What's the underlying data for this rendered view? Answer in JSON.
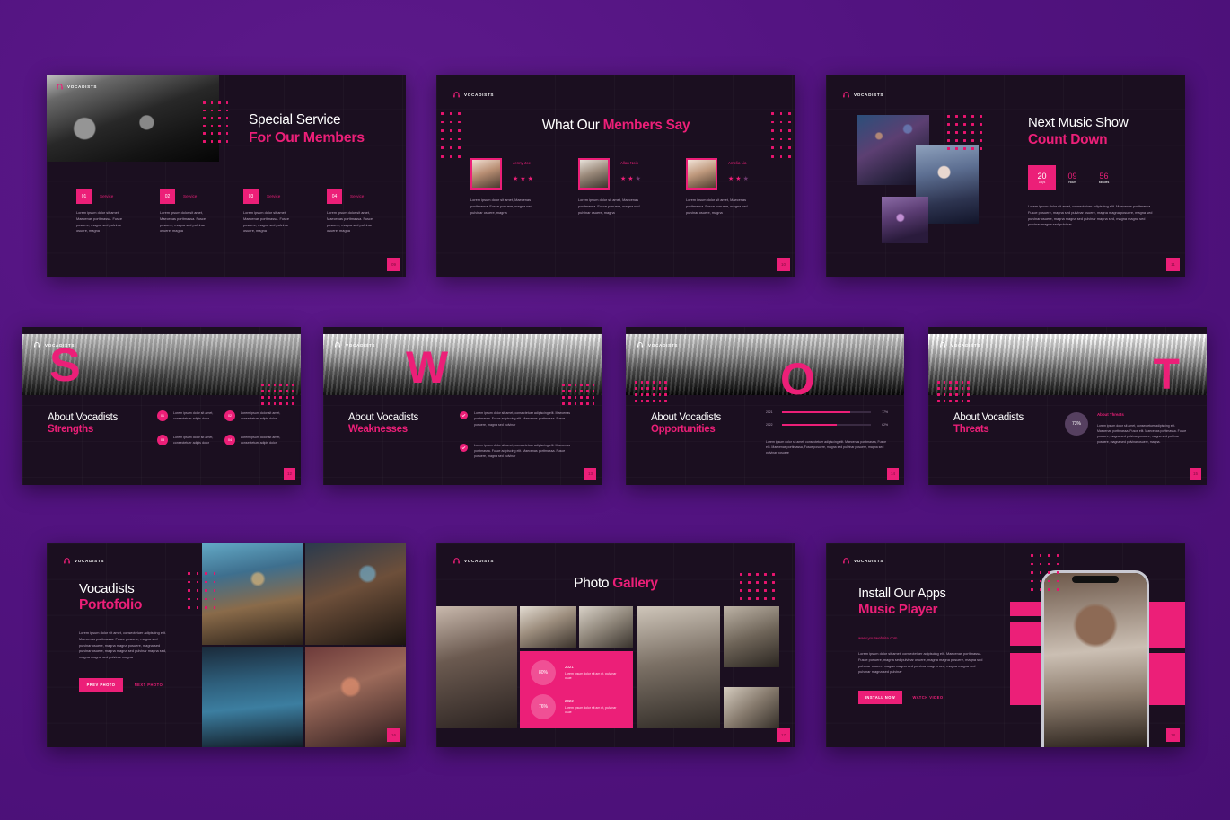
{
  "theme": {
    "bg_purple": "#521380",
    "slide_bg": "#1b0f20",
    "accent_pink": "#ec1f78",
    "text_white": "#ffffff",
    "body_text": "#b9a8bf"
  },
  "brand": {
    "name": "VOCADISTS",
    "icon": "headphones-icon"
  },
  "lorem": {
    "short": "Lorem ipsum dolor sit amet, Maecenas porttmassa. Fusce posuere, magna sed pulvinar osuere, magna",
    "tiny": "Lorem ipsum dolor sit amet, consectetuer adipis dolor",
    "medium": "Lorem ipsum dolor sit amet, consectetuer adipiscing elit. Maecenas porttmassa. Fusce posuere, magna sed pulvinar posuere, magna sed pulvinar posuere",
    "long": "Lorem ipsum dolor sit amet, consectetuer adipiscing elit. Maecenas porttmassa. Fusce posuere, magna sed pulvinar osuere, magna magna posuere, magna sed pulvinar osuere, magna magna sed pulvinar magna sed, magna magna sed pulvinar magna sed pulvinar",
    "portfolio": "Lorem ipsum dolor sit amet, consectetuer adipiscing elit. Maecenas porttmassa. Fusce posuere, magna sed pulvinar osuere, magna magna posuere, magna sed pulvinar osuere, magna magna sed pulvinar magna sed, magna magna sed pulvinar magna",
    "weakness": "Lorem ipsum dolor sit amet, consectetuer adipiscing elit. Maecenas porttmassa. Fusce adipiscing elit. Maecenas porttmassa. Fusce posuere, magna sed pulvinar",
    "opportunity": "Lorem ipsum dolor sit amet, consectetuer adipiscing elit. Maecenas porttmassa, Fusce elit. Maecenas porttmassa, Fusce posuere, magna sed pulvinar posuere, magna sed pulvinar posuere",
    "threat": "Lorem ipsum dolor sit amet, consectetuer adipiscing elit. Maecenas porttmassa. Fusce elit. Maecenas porttmassa. Fusce posuere, magna sed pulvinar posuere, magna sed pulvinar posuere, magna sed pulvinar osuere, magna.",
    "stat": "Lorem ipsum dolor sit am et, pulvinar osue"
  },
  "slides": [
    {
      "id": "special-service",
      "page": "09",
      "title_line1": "Special Service",
      "title_line2": "For Our Members",
      "services": [
        {
          "num": "01",
          "label": "Service"
        },
        {
          "num": "02",
          "label": "Service"
        },
        {
          "num": "03",
          "label": "Service"
        },
        {
          "num": "04",
          "label": "Service"
        }
      ]
    },
    {
      "id": "members-say",
      "page": "10",
      "title_line1": "What Our ",
      "title_line2": "Members Say",
      "testimonials": [
        {
          "name": "Jenny Joe",
          "stars": 3,
          "stars_total": 3
        },
        {
          "name": "Allan Nois",
          "stars": 2,
          "stars_total": 3
        },
        {
          "name": "Amelia Lia",
          "stars": 2,
          "stars_total": 3
        }
      ]
    },
    {
      "id": "next-music-show",
      "page": "11",
      "title_line1": "Next Music Show",
      "title_line2": "Count Down",
      "countdown": [
        {
          "value": "20",
          "unit": "Days",
          "active": true
        },
        {
          "value": "09",
          "unit": "Hours",
          "active": false
        },
        {
          "value": "56",
          "unit": "Minutes",
          "active": false
        }
      ]
    },
    {
      "id": "swot-strengths",
      "page": "12",
      "letter": "S",
      "title_line1": "About Vocadists",
      "title_line2": "Strengths",
      "bullets": [
        {
          "num": "01"
        },
        {
          "num": "02"
        },
        {
          "num": "03"
        },
        {
          "num": "04"
        }
      ]
    },
    {
      "id": "swot-weaknesses",
      "page": "13",
      "letter": "W",
      "title_line1": "About Vocadists",
      "title_line2": "Weaknesses",
      "bullets": [
        {
          "icon": "check-icon"
        },
        {
          "icon": "check-icon"
        }
      ]
    },
    {
      "id": "swot-opportunities",
      "page": "14",
      "letter": "O",
      "title_line1": "About Vocadists",
      "title_line2": "Opportunities",
      "bars": [
        {
          "year": "2021",
          "percent": 77,
          "label": "77%"
        },
        {
          "year": "2022",
          "percent": 62,
          "label": "62%"
        }
      ]
    },
    {
      "id": "swot-threats",
      "page": "15",
      "letter": "T",
      "title_line1": "About Vocadists",
      "title_line2": "Threats",
      "circle_value": "73%",
      "sub_heading": "About Threats"
    },
    {
      "id": "portfolio",
      "page": "16",
      "title_line1": "Vocadists",
      "title_line2": "Portofolio",
      "buttons": [
        {
          "label": "PREV PHOTO",
          "style": "filled"
        },
        {
          "label": "NEXT PHOTO",
          "style": "ghost"
        }
      ]
    },
    {
      "id": "photo-gallery",
      "page": "17",
      "title_line1": "Photo ",
      "title_line2": "Gallery",
      "stats": [
        {
          "percent": "80%",
          "year": "2021"
        },
        {
          "percent": "76%",
          "year": "2022"
        }
      ]
    },
    {
      "id": "install-apps",
      "page": "18",
      "title_line1": "Install Our Apps",
      "title_line2": "Music Player",
      "website": "www.yourwebsite.com",
      "buttons": [
        {
          "label": "INSTALL NOW",
          "style": "filled"
        },
        {
          "label": "WATCH VIDEO",
          "style": "ghost"
        }
      ]
    }
  ]
}
